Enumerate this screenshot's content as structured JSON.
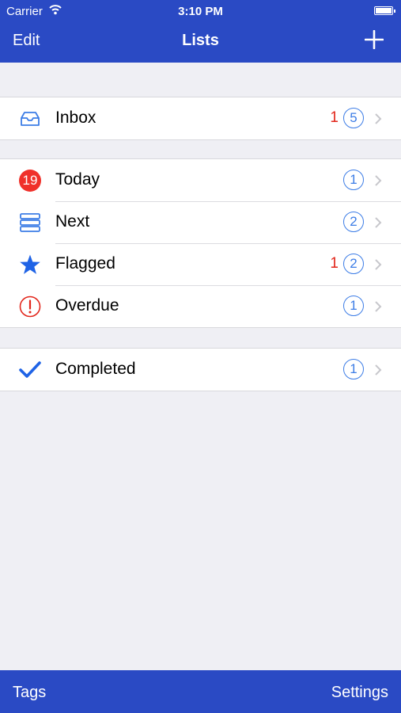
{
  "status_bar": {
    "carrier": "Carrier",
    "time": "3:10 PM"
  },
  "nav": {
    "edit": "Edit",
    "title": "Lists"
  },
  "sections": [
    [
      {
        "label": "Inbox",
        "red_count": "1",
        "count": "5"
      }
    ],
    [
      {
        "label": "Today",
        "date": "19",
        "count": "1"
      },
      {
        "label": "Next",
        "count": "2"
      },
      {
        "label": "Flagged",
        "red_count": "1",
        "count": "2"
      },
      {
        "label": "Overdue",
        "count": "1"
      }
    ],
    [
      {
        "label": "Completed",
        "count": "1"
      }
    ]
  ],
  "toolbar": {
    "tags": "Tags",
    "settings": "Settings"
  },
  "colors": {
    "bar": "#2a4ac4",
    "accent": "#3d7de6",
    "alert": "#e2261b",
    "background": "#efeff4"
  }
}
